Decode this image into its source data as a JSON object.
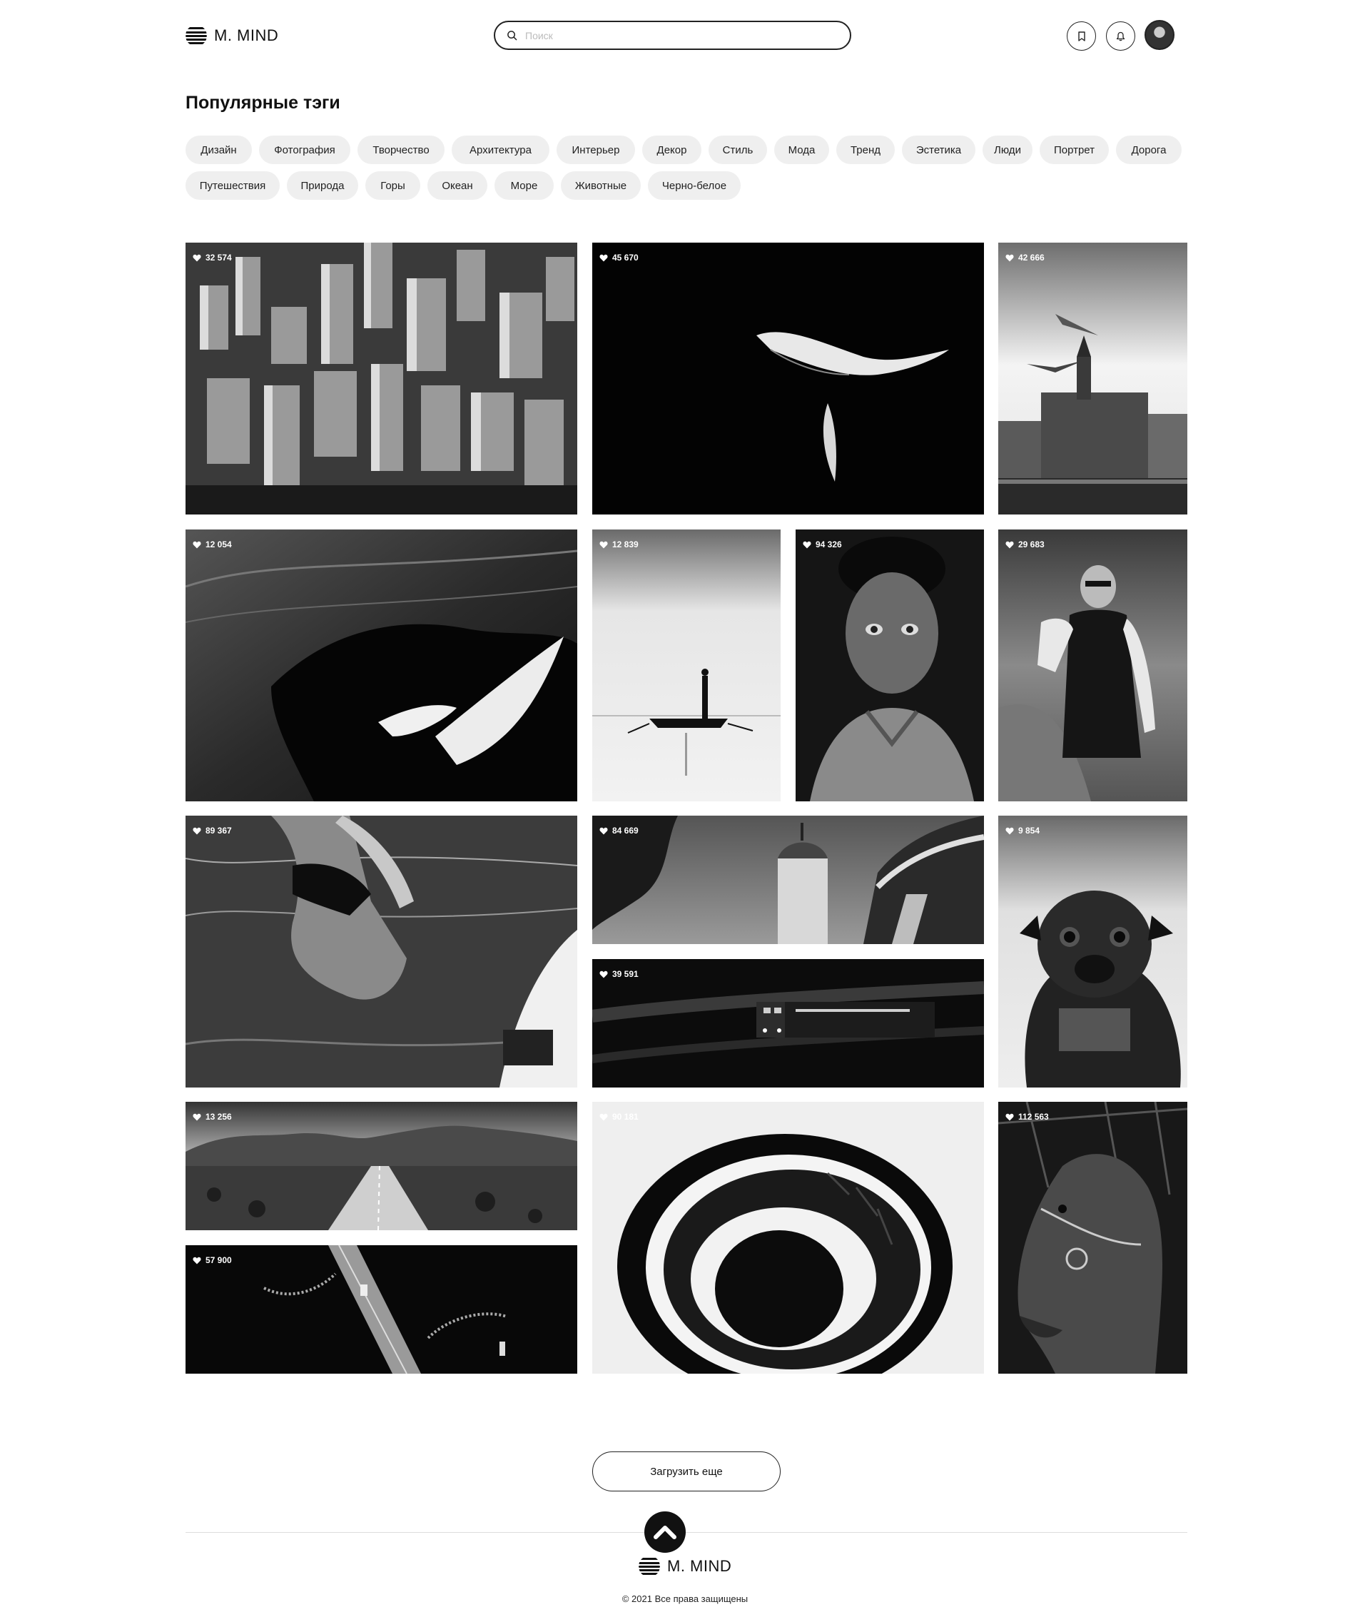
{
  "header": {
    "logo_text": "M. MIND",
    "search_placeholder": "Поиск"
  },
  "tags_section": {
    "title": "Популярные тэги",
    "tags": [
      "Дизайн",
      "Фотография",
      "Творчество",
      "Архитектура",
      "Интерьер",
      "Декор",
      "Стиль",
      "Мода",
      "Тренд",
      "Эстетика",
      "Люди",
      "Портрет",
      "Дорога",
      "Путешествия",
      "Природа",
      "Горы",
      "Океан",
      "Море",
      "Животные",
      "Черно-белое"
    ]
  },
  "gallery": {
    "photos": [
      {
        "subject": "city-aerial",
        "likes": "32 574"
      },
      {
        "subject": "whale-night",
        "likes": "45 670"
      },
      {
        "subject": "seagulls-castle",
        "likes": "42 666"
      },
      {
        "subject": "orca-water",
        "likes": "12 054"
      },
      {
        "subject": "boat-fisherman",
        "likes": "12 839"
      },
      {
        "subject": "boy-portrait",
        "likes": "94 326"
      },
      {
        "subject": "woman-sunglasses",
        "likes": "29 683"
      },
      {
        "subject": "woman-surf",
        "likes": "89 367"
      },
      {
        "subject": "church-tower",
        "likes": "84 669"
      },
      {
        "subject": "train-night",
        "likes": "39 591"
      },
      {
        "subject": "pug-dog",
        "likes": "9 854"
      },
      {
        "subject": "desert-road",
        "likes": "13 256"
      },
      {
        "subject": "bridge-aerial",
        "likes": "57 900"
      },
      {
        "subject": "spiral-stairs",
        "likes": "90 181"
      },
      {
        "subject": "horse-bridle",
        "likes": "112 563"
      }
    ]
  },
  "load_more_label": "Загрузить еще",
  "footer": {
    "logo_text": "M. MIND",
    "copyright": "© 2021 Все права защищены"
  },
  "icons": {
    "search": "search-icon",
    "bookmark": "bookmark-icon",
    "bell": "bell-icon",
    "like": "heart-icon",
    "scroll_top": "chevron-up-icon"
  },
  "colors": {
    "accent": "#111111",
    "tag_bg": "#efefef",
    "border": "#222222"
  }
}
